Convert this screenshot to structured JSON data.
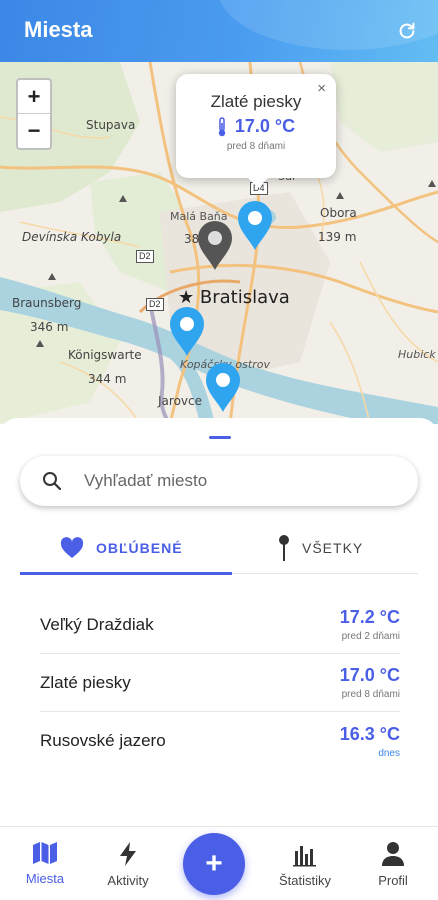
{
  "header": {
    "title": "Miesta",
    "refresh_icon": "refresh-icon"
  },
  "map": {
    "zoom_in": "+",
    "zoom_out": "−",
    "labels": {
      "stupava": "Stupava",
      "mala_bana": "Malá Baňa",
      "devinska_kobyla": "Devínska Kobyla",
      "obora": "Obora",
      "obora_height": "139 m",
      "height_38": "38",
      "braunsberg": "Braunsberg",
      "braunsberg_height": "346 m",
      "konigswarte": "Königswarte",
      "konigswarte_height": "344 m",
      "bratislava": "Bratislava",
      "kopacsky_ostrov": "Kopáčsky ostrov",
      "jarovce": "Jarovce",
      "hubicka": "Hubick",
      "sur": "Šur"
    },
    "road_tags": {
      "d2_top": "D2",
      "d2_bottom": "D2",
      "d4": "D4"
    },
    "popup": {
      "name": "Zlaté piesky",
      "temperature": "17.0 °C",
      "updated": "pred 8 dňami",
      "close": "×"
    }
  },
  "search": {
    "placeholder": "Vyhľadať miesto"
  },
  "tabs": {
    "favorites": "OBĽÚBENÉ",
    "all": "VŠETKY"
  },
  "places": [
    {
      "name": "Veľký Draždiak",
      "temperature": "17.2 °C",
      "updated": "pred 2 dňami"
    },
    {
      "name": "Zlaté piesky",
      "temperature": "17.0 °C",
      "updated": "pred 8 dňami"
    },
    {
      "name": "Rusovské jazero",
      "temperature": "16.3 °C",
      "updated": "dnes"
    }
  ],
  "nav": {
    "places": "Miesta",
    "activities": "Aktivity",
    "add": "+",
    "statistics": "Štatistiky",
    "profile": "Profil"
  },
  "colors": {
    "accent": "#4a5ee6",
    "header": "#3c87e6",
    "pin_blue": "#2fa5f0",
    "pin_gray": "#555555"
  }
}
